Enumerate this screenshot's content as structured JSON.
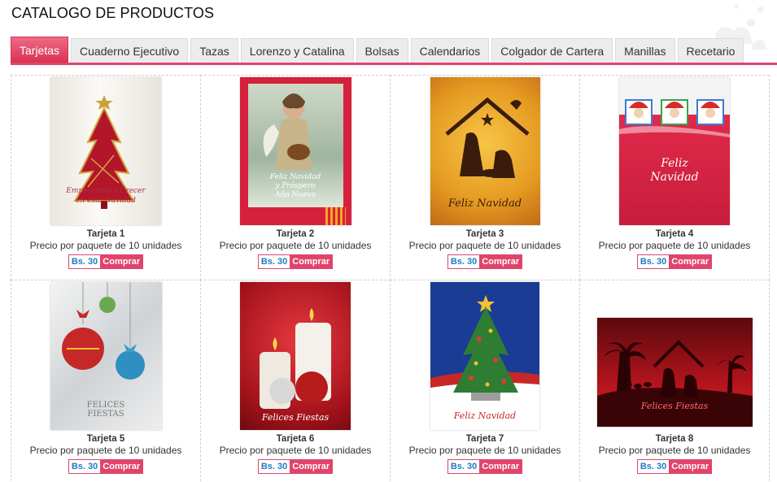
{
  "page": {
    "title": "CATALOGO DE PRODUCTOS"
  },
  "tabs": [
    {
      "label": "Tarjetas",
      "active": true
    },
    {
      "label": "Cuaderno Ejecutivo"
    },
    {
      "label": "Tazas"
    },
    {
      "label": "Lorenzo y Catalina"
    },
    {
      "label": "Bolsas"
    },
    {
      "label": "Calendarios"
    },
    {
      "label": "Colgador de Cartera"
    },
    {
      "label": "Manillas"
    },
    {
      "label": "Recetario"
    }
  ],
  "products": [
    {
      "name": "Tarjeta 1",
      "description": "Precio por paquete de 10 unidades",
      "price": "Bs. 30",
      "buy_label": "Comprar",
      "card_text": [
        "Empecemos a Crecer",
        "en esta Navidad"
      ]
    },
    {
      "name": "Tarjeta 2",
      "description": "Precio por paquete de 10 unidades",
      "price": "Bs. 30",
      "buy_label": "Comprar",
      "card_text": [
        "Feliz Navidad",
        "y Próspero",
        "Año Nuevo"
      ]
    },
    {
      "name": "Tarjeta 3",
      "description": "Precio por paquete de 10 unidades",
      "price": "Bs. 30",
      "buy_label": "Comprar",
      "card_text": [
        "Feliz Navidad"
      ]
    },
    {
      "name": "Tarjeta 4",
      "description": "Precio por paquete de 10 unidades",
      "price": "Bs. 30",
      "buy_label": "Comprar",
      "card_text": [
        "Feliz",
        "Navidad"
      ]
    },
    {
      "name": "Tarjeta 5",
      "description": "Precio por paquete de 10 unidades",
      "price": "Bs. 30",
      "buy_label": "Comprar",
      "card_text": [
        "FELICES",
        "FIESTAS"
      ]
    },
    {
      "name": "Tarjeta 6",
      "description": "Precio por paquete de 10 unidades",
      "price": "Bs. 30",
      "buy_label": "Comprar",
      "card_text": [
        "Felices Fiestas"
      ]
    },
    {
      "name": "Tarjeta 7",
      "description": "Precio por paquete de 10 unidades",
      "price": "Bs. 30",
      "buy_label": "Comprar",
      "card_text": [
        "Feliz Navidad"
      ]
    },
    {
      "name": "Tarjeta 8",
      "description": "Precio por paquete de 10 unidades",
      "price": "Bs. 30",
      "buy_label": "Comprar",
      "card_text": [
        "Felices Fiestas"
      ]
    }
  ],
  "colors": {
    "accent": "#e0446a",
    "price_text": "#1c7cc4"
  }
}
